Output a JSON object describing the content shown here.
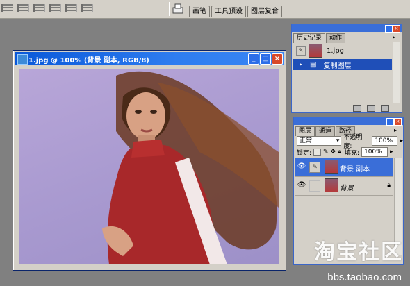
{
  "options_bar": {
    "brush_wells": [
      "画笔",
      "工具预设",
      "图层复合"
    ]
  },
  "document": {
    "title": "1.jpg @ 100% (背景 副本, RGB/8)",
    "buttons": {
      "minimize": "_",
      "maximize": "□",
      "close": "×"
    }
  },
  "history_panel": {
    "tabs": [
      "历史记录",
      "动作"
    ],
    "snapshot_name": "1.jpg",
    "steps": [
      "复制图层"
    ]
  },
  "layers_panel": {
    "tabs": [
      "图层",
      "通道",
      "路径"
    ],
    "blend_mode": "正常",
    "opacity_label": "不透明度:",
    "opacity_value": "100%",
    "lock_label": "锁定:",
    "fill_label": "填充:",
    "fill_value": "100%",
    "layers": [
      {
        "name": "背景 副本",
        "selected": true
      },
      {
        "name": "背景",
        "selected": false
      }
    ]
  },
  "watermark": {
    "text": "淘宝社区",
    "url": "bbs.taobao.com"
  },
  "colors": {
    "titlebar": "#0a58d8",
    "selection": "#3a6ed8",
    "panel_bg": "#d4d0c8",
    "canvas_bg": "#a99ad0"
  }
}
